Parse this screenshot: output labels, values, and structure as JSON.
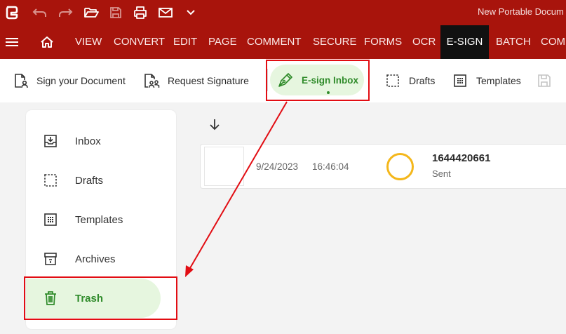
{
  "titlebar": {
    "document_title": "New Portable Docum"
  },
  "menubar": {
    "tabs": [
      {
        "label": "VIEW"
      },
      {
        "label": "CONVERT"
      },
      {
        "label": "EDIT"
      },
      {
        "label": "PAGE"
      },
      {
        "label": "COMMENT"
      },
      {
        "label": "SECURE"
      },
      {
        "label": "FORMS"
      },
      {
        "label": "OCR"
      },
      {
        "label": "E-SIGN",
        "active": true
      },
      {
        "label": "BATCH"
      },
      {
        "label": "COMM"
      }
    ]
  },
  "toolbar": {
    "items": [
      {
        "label": "Sign your Document",
        "icon": "person-document-icon"
      },
      {
        "label": "Request Signature",
        "icon": "people-document-icon"
      },
      {
        "label": "E-sign Inbox",
        "icon": "pen-nib-icon",
        "active": true
      },
      {
        "label": "Drafts",
        "icon": "dashed-square-icon"
      },
      {
        "label": "Templates",
        "icon": "dotted-grid-icon"
      },
      {
        "label": "",
        "icon": "save-icon",
        "disabled": true
      }
    ]
  },
  "sidebar": {
    "items": [
      {
        "label": "Inbox",
        "icon": "inbox-tray-icon"
      },
      {
        "label": "Drafts",
        "icon": "dashed-square-icon"
      },
      {
        "label": "Templates",
        "icon": "dotted-grid-icon"
      },
      {
        "label": "Archives",
        "icon": "archive-box-icon"
      },
      {
        "label": "Trash",
        "icon": "trash-icon",
        "active": true
      }
    ]
  },
  "documents": [
    {
      "date": "9/24/2023",
      "time": "16:46:04",
      "id": "1644420661",
      "status": "Sent"
    }
  ],
  "colors": {
    "brand_red": "#a8140c",
    "active_tab_bg": "#111111",
    "active_green": "#2f8b2a",
    "active_green_bg": "#e6f6df",
    "annotation_red": "#e20d13",
    "status_ring": "#f4b71b"
  }
}
